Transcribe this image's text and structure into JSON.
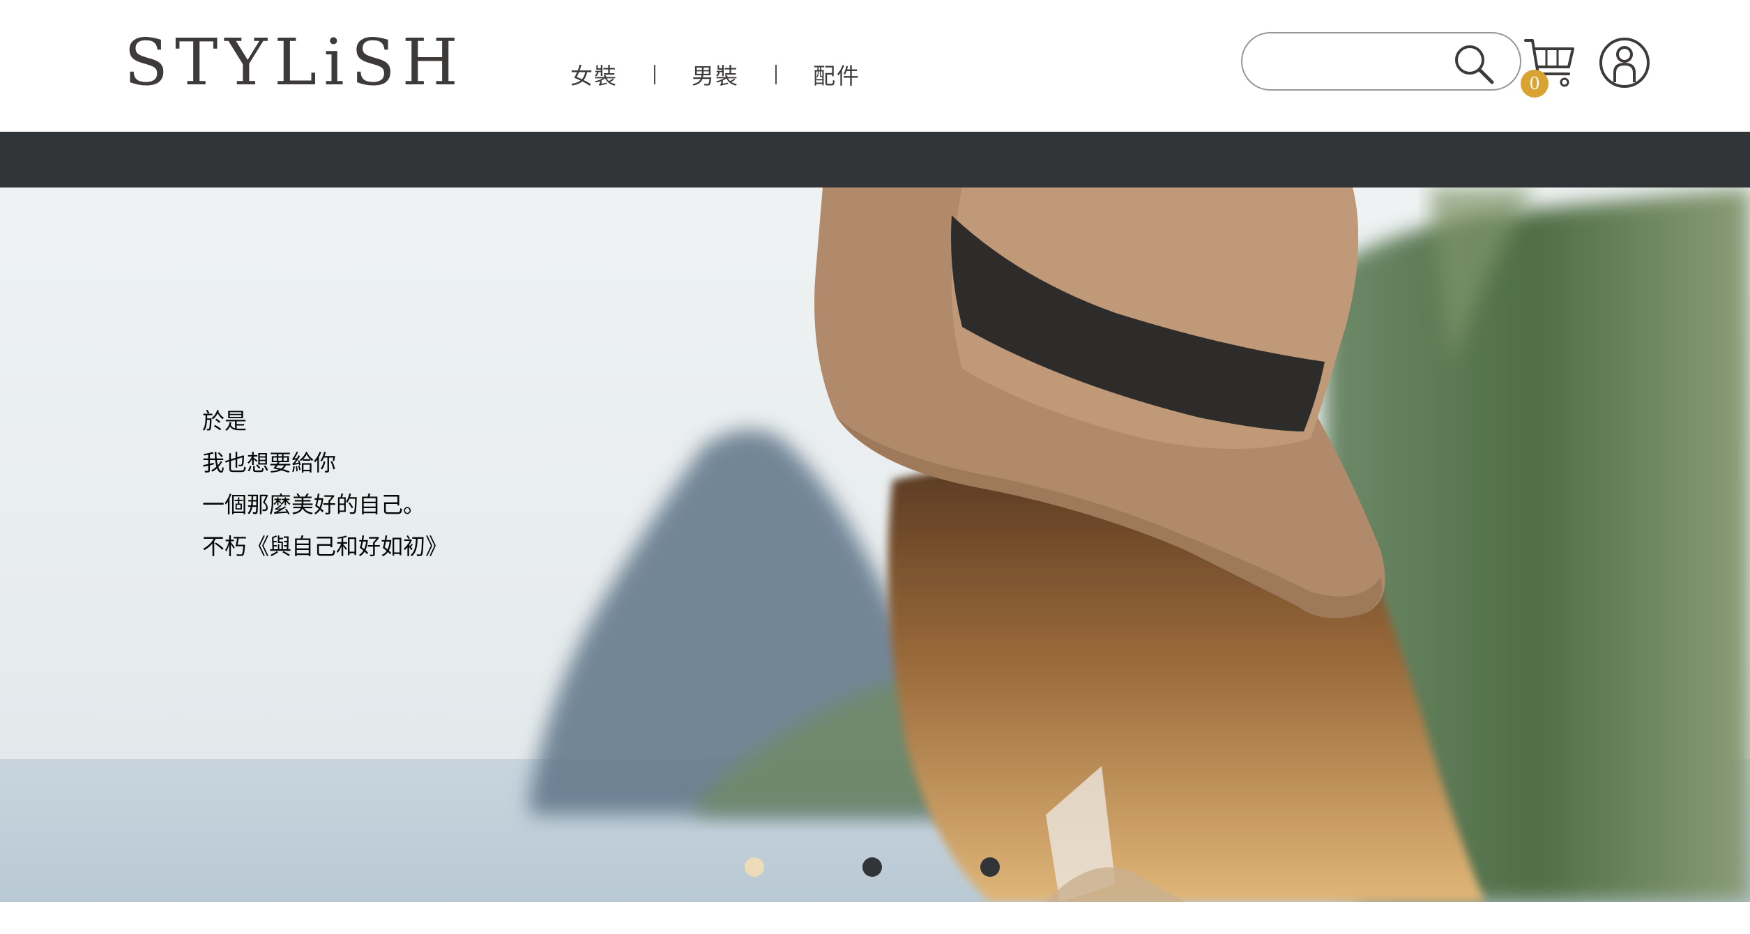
{
  "header": {
    "logo": "STYLiSH",
    "nav": [
      "女裝",
      "男裝",
      "配件"
    ],
    "search": {
      "value": "",
      "placeholder": ""
    },
    "cart_count": "0"
  },
  "hero": {
    "lines": [
      "於是",
      "我也想要給你",
      "一個那麼美好的自己。",
      "不朽《與自己和好如初》"
    ]
  },
  "carousel": {
    "dot_count": 3,
    "active_index": 0
  },
  "colors": {
    "brand_text": "#3f3a3a",
    "dark_bar": "#313538",
    "badge": "#d9a332",
    "dot_active": "#f5deb3"
  },
  "icons": [
    "search-icon",
    "cart-icon",
    "member-icon"
  ]
}
